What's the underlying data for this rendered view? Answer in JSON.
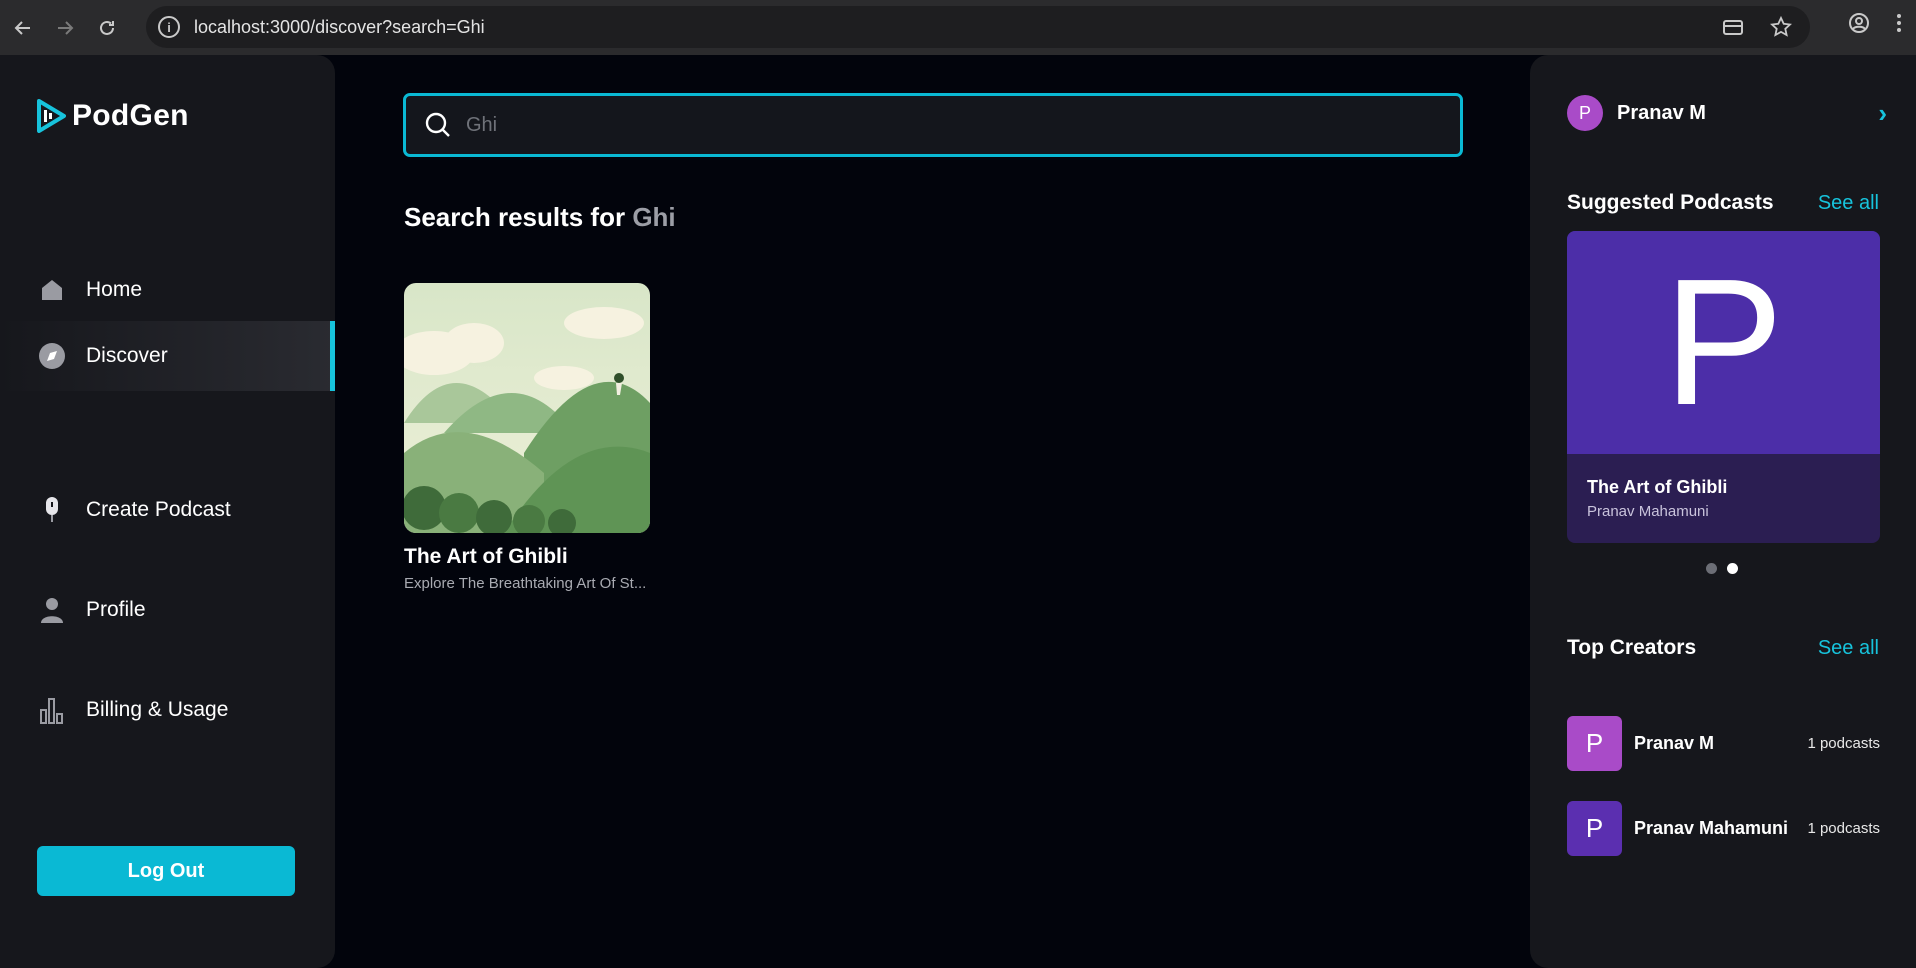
{
  "browser": {
    "url": "localhost:3000/discover?search=Ghi",
    "back_icon": "arrow-left-icon",
    "forward_icon": "arrow-right-icon",
    "reload_icon": "reload-icon"
  },
  "app": {
    "name": "PodGen",
    "accent": "#0ab9d4"
  },
  "sidebar": {
    "items": [
      {
        "label": "Home",
        "icon": "home-icon"
      },
      {
        "label": "Discover",
        "icon": "compass-icon",
        "active": true
      },
      {
        "label": "Create Podcast",
        "icon": "microphone-icon"
      },
      {
        "label": "Profile",
        "icon": "user-icon"
      },
      {
        "label": "Billing & Usage",
        "icon": "bar-chart-icon"
      }
    ],
    "logout_label": "Log Out"
  },
  "search": {
    "value": "Ghi"
  },
  "results": {
    "prefix": "Search results for",
    "term": "Ghi",
    "items": [
      {
        "title": "The Art of Ghibli",
        "description": "Explore The Breathtaking Art Of St..."
      }
    ]
  },
  "right": {
    "user": {
      "initial": "P",
      "name": "Pranav M"
    },
    "suggested": {
      "title": "Suggested Podcasts",
      "see_all": "See all",
      "card": {
        "initial": "P",
        "title": "The Art of Ghibli",
        "author": "Pranav Mahamuni"
      },
      "active_dot": 2
    },
    "creators": {
      "title": "Top Creators",
      "see_all": "See all",
      "items": [
        {
          "initial": "P",
          "name": "Pranav M",
          "count": "1 podcasts",
          "color": "#a94bc8"
        },
        {
          "initial": "P",
          "name": "Pranav Mahamuni",
          "count": "1 podcasts",
          "color": "#5b2fb0"
        }
      ]
    }
  }
}
